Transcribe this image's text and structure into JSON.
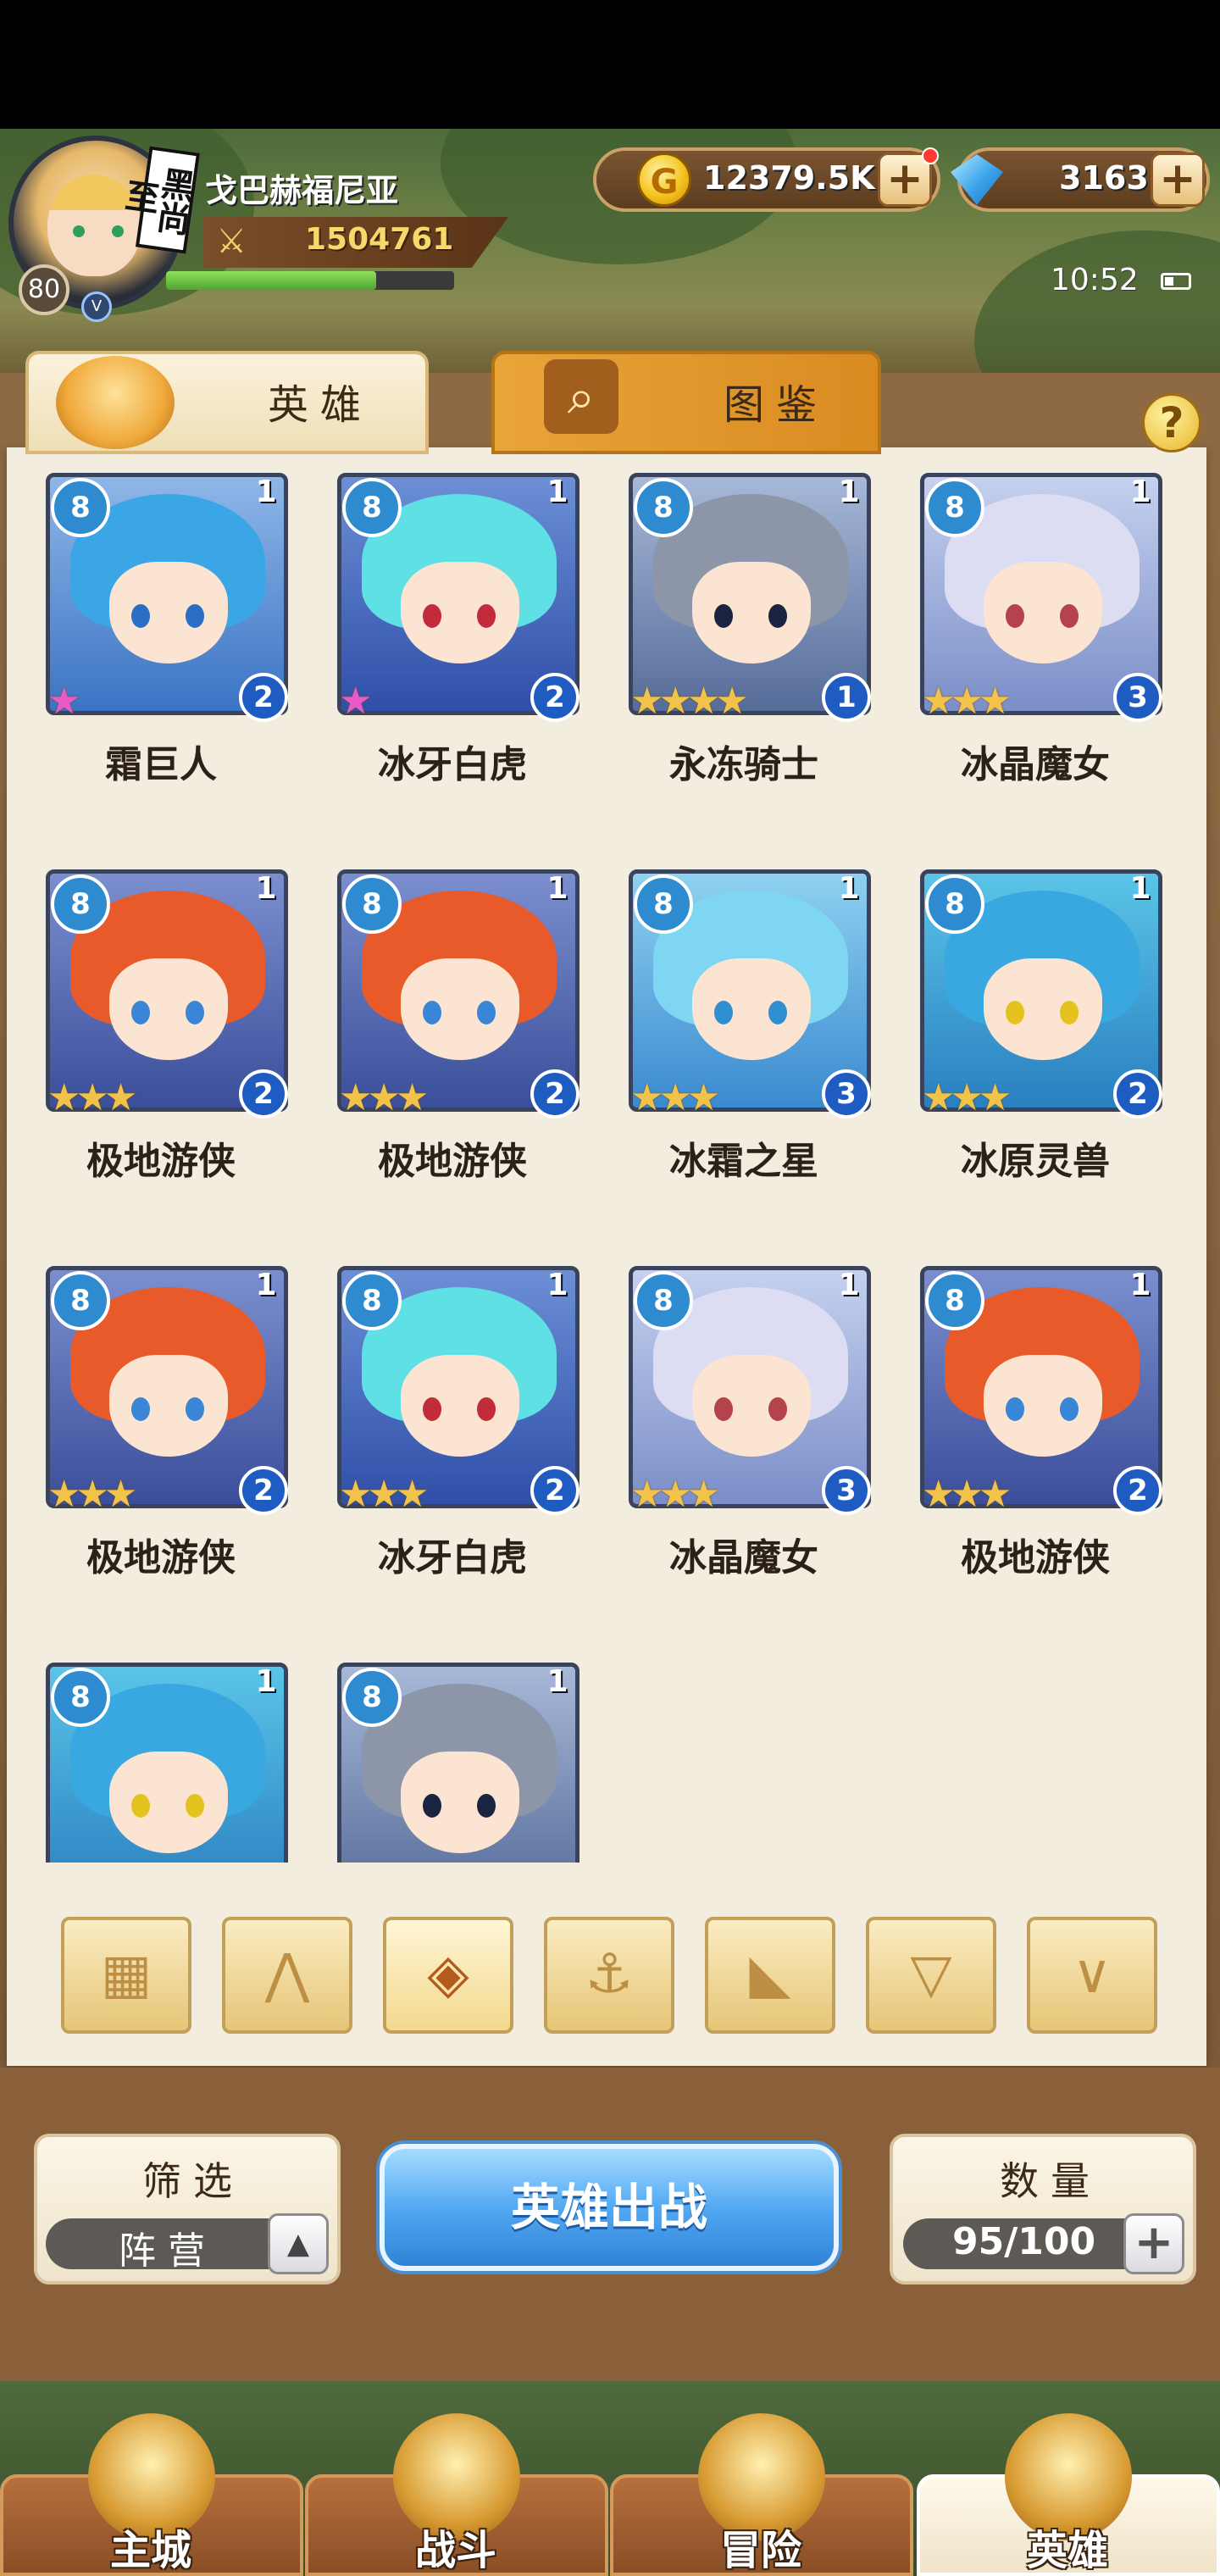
{
  "player": {
    "name": "戈巴赫福尼亚",
    "power": "1504761",
    "level": "80",
    "badge_text": "黑尚至",
    "exp_fraction": 0.73
  },
  "currency": {
    "gold": "12379.5K",
    "gold_icon": "G",
    "gems": "3163"
  },
  "status": {
    "time": "10:52"
  },
  "tabs": [
    {
      "label": "英雄",
      "active": true,
      "icon": "helmet-icon"
    },
    {
      "label": "图鉴",
      "active": false,
      "icon": "magnifier-icon"
    }
  ],
  "help_label": "?",
  "heroes": [
    {
      "name": "霜巨人",
      "tier": "1",
      "level": "2",
      "stars": 1,
      "rainbow": true,
      "faction": "8",
      "theme": "blue-hair"
    },
    {
      "name": "冰牙白虎",
      "tier": "1",
      "level": "2",
      "stars": 1,
      "rainbow": true,
      "faction": "8",
      "theme": "cyan-hair"
    },
    {
      "name": "永冻骑士",
      "tier": "1",
      "level": "1",
      "stars": 4,
      "rainbow": false,
      "faction": "8",
      "theme": "knight"
    },
    {
      "name": "冰晶魔女",
      "tier": "1",
      "level": "3",
      "stars": 3,
      "rainbow": false,
      "faction": "8",
      "theme": "silver-hair"
    },
    {
      "name": "极地游侠",
      "tier": "1",
      "level": "2",
      "stars": 3,
      "rainbow": false,
      "faction": "8",
      "theme": "tiger-hood"
    },
    {
      "name": "极地游侠",
      "tier": "1",
      "level": "2",
      "stars": 3,
      "rainbow": false,
      "faction": "8",
      "theme": "tiger-hood"
    },
    {
      "name": "冰霜之星",
      "tier": "1",
      "level": "3",
      "stars": 3,
      "rainbow": false,
      "faction": "8",
      "theme": "cyan-twin"
    },
    {
      "name": "冰原灵兽",
      "tier": "1",
      "level": "2",
      "stars": 3,
      "rainbow": false,
      "faction": "8",
      "theme": "beast"
    },
    {
      "name": "极地游侠",
      "tier": "1",
      "level": "2",
      "stars": 3,
      "rainbow": false,
      "faction": "8",
      "theme": "tiger-hood"
    },
    {
      "name": "冰牙白虎",
      "tier": "1",
      "level": "2",
      "stars": 3,
      "rainbow": false,
      "faction": "8",
      "theme": "cyan-hair"
    },
    {
      "name": "冰晶魔女",
      "tier": "1",
      "level": "3",
      "stars": 3,
      "rainbow": false,
      "faction": "8",
      "theme": "silver-hair"
    },
    {
      "name": "极地游侠",
      "tier": "1",
      "level": "2",
      "stars": 3,
      "rainbow": false,
      "faction": "8",
      "theme": "tiger-hood"
    },
    {
      "name": "",
      "tier": "1",
      "level": "",
      "stars": 0,
      "rainbow": false,
      "faction": "8",
      "theme": "beast"
    },
    {
      "name": "",
      "tier": "1",
      "level": "",
      "stars": 0,
      "rainbow": false,
      "faction": "8",
      "theme": "knight"
    }
  ],
  "faction_filters": [
    {
      "icon": "grid-icon",
      "glyph": "▦",
      "active": false
    },
    {
      "icon": "leaf-icon",
      "glyph": "⋀",
      "active": false
    },
    {
      "icon": "ice-diamond-icon",
      "glyph": "◈",
      "active": true
    },
    {
      "icon": "anchor-icon",
      "glyph": "⚓",
      "active": false
    },
    {
      "icon": "beast-head-icon",
      "glyph": "◣",
      "active": false
    },
    {
      "icon": "horns-icon",
      "glyph": "▽",
      "active": false
    },
    {
      "icon": "wings-icon",
      "glyph": "∨",
      "active": false
    }
  ],
  "controls": {
    "filter_title": "筛选",
    "filter_value": "阵营",
    "deploy_label": "英雄出战",
    "count_title": "数量",
    "count_value": "95/100"
  },
  "nav": [
    {
      "label": "主城",
      "icon": "castle-icon",
      "active": false
    },
    {
      "label": "战斗",
      "icon": "crossed-swords-icon",
      "active": false
    },
    {
      "label": "冒险",
      "icon": "scroll-map-icon",
      "active": false
    },
    {
      "label": "英雄",
      "icon": "hero-crest-icon",
      "active": true
    }
  ],
  "colors": {
    "faction_blue": "#2f8bd0",
    "level_blue": "#1f5cc2",
    "star_gold": "#f2c34a",
    "deploy_blue": "#53a9f2"
  }
}
